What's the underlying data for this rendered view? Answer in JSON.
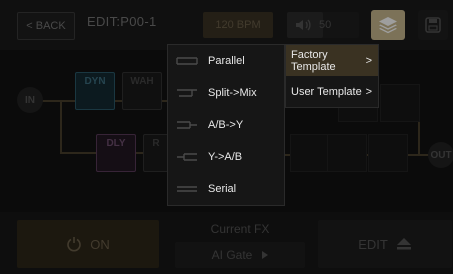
{
  "topbar": {
    "back_label": "< BACK",
    "title": "EDIT:P00-1",
    "bpm": "120 BPM",
    "volume": "50",
    "volume_level": 0.5
  },
  "chain": {
    "in_label": "IN",
    "out_label": "OUT",
    "blocks": [
      "DYN",
      "WAH",
      "DLY",
      "R"
    ]
  },
  "bottom": {
    "on_label": "ON",
    "current_fx_label": "Current FX",
    "current_fx_value": "AI Gate",
    "edit_label": "EDIT"
  },
  "routing_menu": {
    "items": [
      "Parallel",
      "Split->Mix",
      "A/B->Y",
      "Y->A/B",
      "Serial"
    ]
  },
  "template_menu": {
    "items": [
      {
        "label": "Factory Template",
        "arrow": ">"
      },
      {
        "label": "User Template",
        "arrow": ">"
      }
    ]
  },
  "colors": {
    "accent": "#c9b98f",
    "active_item": "#3a3222"
  }
}
